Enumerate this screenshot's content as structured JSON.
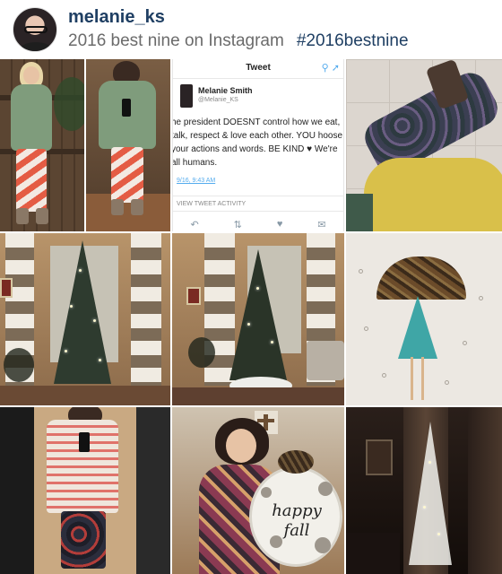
{
  "profile": {
    "username": "melanie_ks",
    "caption": "2016 best nine on Instagram",
    "hashtag": "#2016bestnine"
  },
  "tweet": {
    "header_title": "Tweet",
    "author_name": "Melanie Smith",
    "author_handle": "@Melanie_KS",
    "text": "he president DOESNT control how we eat, talk, respect & love each other. YOU hoose your actions and words. BE KIND ♥ We're all humans.",
    "time": "9/16, 9:43 AM",
    "activity_label": "VIEW TWEET ACTIVITY"
  },
  "photos": {
    "fall_sign_line1": "happy",
    "fall_sign_line2": "fall"
  },
  "colors": {
    "username": "#1f3f63",
    "hashtag": "#1f3f63",
    "caption": "#6b6b6b",
    "twitter_blue": "#55acee"
  }
}
